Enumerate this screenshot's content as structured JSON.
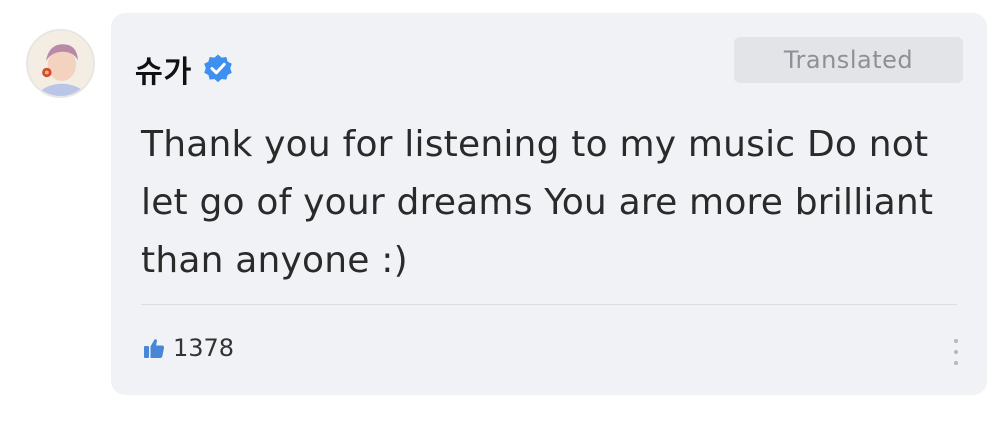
{
  "post": {
    "author": "슈가",
    "translated_label": "Translated",
    "message": "Thank you for listening to my music Do not let go of your dreams You are more brilliant than anyone :)",
    "like_count": "1378"
  },
  "icons": {
    "verified": "verified-badge-icon",
    "like": "thumbs-up-icon",
    "more": "more-vertical-icon"
  },
  "colors": {
    "card_background": "#f1f2f5",
    "verified_blue": "#3d8ff0",
    "like_blue": "#4a86d6",
    "translated_button_bg": "#e3e4e8"
  }
}
